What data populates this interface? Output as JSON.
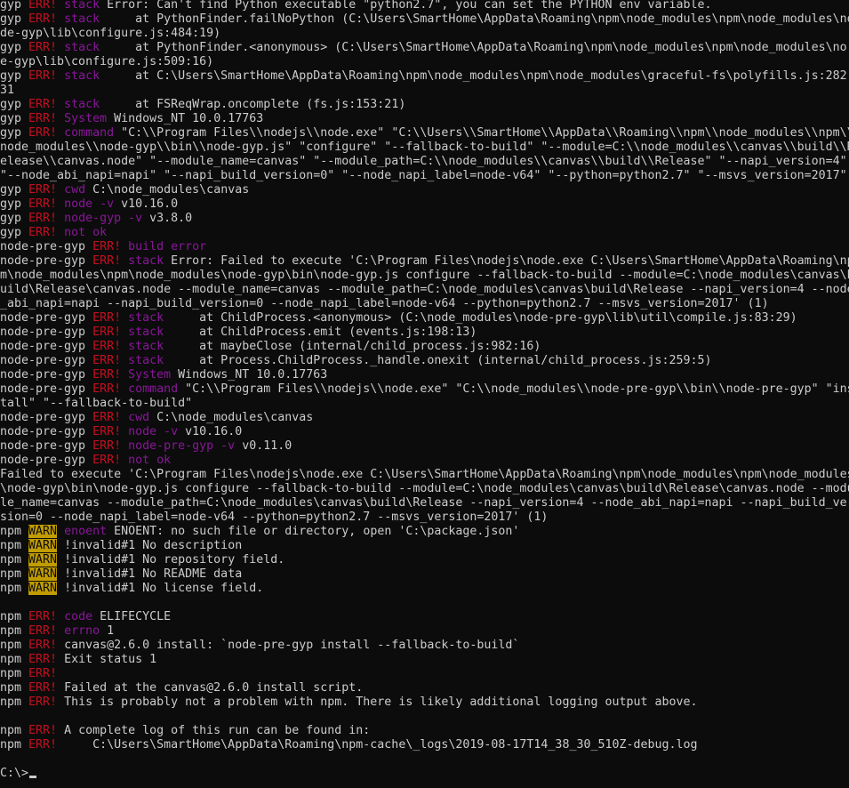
{
  "terminal": {
    "colors": {
      "background": "#0c0c0c",
      "foreground": "#cccccc",
      "err": "#c50f1f",
      "magenta": "#881798",
      "warn_bg": "#c19c00"
    },
    "lines": [
      [
        [
          "w",
          "gyp "
        ],
        [
          "r",
          "ERR! "
        ],
        [
          "m",
          "stack"
        ],
        [
          "w",
          " Error: Can't find Python executable \"python2.7\", you can set the PYTHON env variable."
        ]
      ],
      [
        [
          "w",
          "gyp "
        ],
        [
          "r",
          "ERR! "
        ],
        [
          "m",
          "stack"
        ],
        [
          "w",
          "     at PythonFinder.failNoPython (C:\\Users\\SmartHome\\AppData\\Roaming\\npm\\node_modules\\npm\\node_modules\\no"
        ]
      ],
      [
        [
          "w",
          "de-gyp\\lib\\configure.js:484:19)"
        ]
      ],
      [
        [
          "w",
          "gyp "
        ],
        [
          "r",
          "ERR! "
        ],
        [
          "m",
          "stack"
        ],
        [
          "w",
          "     at PythonFinder.<anonymous> (C:\\Users\\SmartHome\\AppData\\Roaming\\npm\\node_modules\\npm\\node_modules\\no"
        ]
      ],
      [
        [
          "w",
          "e-gyp\\lib\\configure.js:509:16)"
        ]
      ],
      [
        [
          "w",
          "gyp "
        ],
        [
          "r",
          "ERR! "
        ],
        [
          "m",
          "stack"
        ],
        [
          "w",
          "     at C:\\Users\\SmartHome\\AppData\\Roaming\\npm\\node_modules\\npm\\node_modules\\graceful-fs\\polyfills.js:282:"
        ]
      ],
      [
        [
          "w",
          "31"
        ]
      ],
      [
        [
          "w",
          "gyp "
        ],
        [
          "r",
          "ERR! "
        ],
        [
          "m",
          "stack"
        ],
        [
          "w",
          "     at FSReqWrap.oncomplete (fs.js:153:21)"
        ]
      ],
      [
        [
          "w",
          "gyp "
        ],
        [
          "r",
          "ERR! "
        ],
        [
          "m",
          "System"
        ],
        [
          "w",
          " Windows_NT 10.0.17763"
        ]
      ],
      [
        [
          "w",
          "gyp "
        ],
        [
          "r",
          "ERR! "
        ],
        [
          "m",
          "command"
        ],
        [
          "w",
          " \"C:\\\\Program Files\\\\nodejs\\\\node.exe\" \"C:\\\\Users\\\\SmartHome\\\\AppData\\\\Roaming\\\\npm\\\\node_modules\\\\npm\\\\"
        ]
      ],
      [
        [
          "w",
          "node_modules\\\\node-gyp\\\\bin\\\\node-gyp.js\" \"configure\" \"--fallback-to-build\" \"--module=C:\\\\node_modules\\\\canvas\\\\build\\\\R"
        ]
      ],
      [
        [
          "w",
          "elease\\\\canvas.node\" \"--module_name=canvas\" \"--module_path=C:\\\\node_modules\\\\canvas\\\\build\\\\Release\" \"--napi_version=4\" "
        ]
      ],
      [
        [
          "w",
          "\"--node_abi_napi=napi\" \"--napi_build_version=0\" \"--node_napi_label=node-v64\" \"--python=python2.7\" \"--msvs_version=2017\" "
        ]
      ],
      [
        [
          "w",
          "gyp "
        ],
        [
          "r",
          "ERR! "
        ],
        [
          "m",
          "cwd"
        ],
        [
          "w",
          " C:\\node_modules\\canvas"
        ]
      ],
      [
        [
          "w",
          "gyp "
        ],
        [
          "r",
          "ERR! "
        ],
        [
          "m",
          "node -v"
        ],
        [
          "w",
          " v10.16.0"
        ]
      ],
      [
        [
          "w",
          "gyp "
        ],
        [
          "r",
          "ERR! "
        ],
        [
          "m",
          "node-gyp -v"
        ],
        [
          "w",
          " v3.8.0"
        ]
      ],
      [
        [
          "w",
          "gyp "
        ],
        [
          "r",
          "ERR! "
        ],
        [
          "m",
          "not ok"
        ]
      ],
      [
        [
          "w",
          "node-pre-gyp "
        ],
        [
          "r",
          "ERR! "
        ],
        [
          "m",
          "build error"
        ]
      ],
      [
        [
          "w",
          "node-pre-gyp "
        ],
        [
          "r",
          "ERR! "
        ],
        [
          "m",
          "stack"
        ],
        [
          "w",
          " Error: Failed to execute 'C:\\Program Files\\nodejs\\node.exe C:\\Users\\SmartHome\\AppData\\Roaming\\np"
        ]
      ],
      [
        [
          "w",
          "m\\node_modules\\npm\\node_modules\\node-gyp\\bin\\node-gyp.js configure --fallback-to-build --module=C:\\node_modules\\canvas\\b"
        ]
      ],
      [
        [
          "w",
          "uild\\Release\\canvas.node --module_name=canvas --module_path=C:\\node_modules\\canvas\\build\\Release --napi_version=4 --node"
        ]
      ],
      [
        [
          "w",
          "_abi_napi=napi --napi_build_version=0 --node_napi_label=node-v64 --python=python2.7 --msvs_version=2017' (1)"
        ]
      ],
      [
        [
          "w",
          "node-pre-gyp "
        ],
        [
          "r",
          "ERR! "
        ],
        [
          "m",
          "stack"
        ],
        [
          "w",
          "     at ChildProcess.<anonymous> (C:\\node_modules\\node-pre-gyp\\lib\\util\\compile.js:83:29)"
        ]
      ],
      [
        [
          "w",
          "node-pre-gyp "
        ],
        [
          "r",
          "ERR! "
        ],
        [
          "m",
          "stack"
        ],
        [
          "w",
          "     at ChildProcess.emit (events.js:198:13)"
        ]
      ],
      [
        [
          "w",
          "node-pre-gyp "
        ],
        [
          "r",
          "ERR! "
        ],
        [
          "m",
          "stack"
        ],
        [
          "w",
          "     at maybeClose (internal/child_process.js:982:16)"
        ]
      ],
      [
        [
          "w",
          "node-pre-gyp "
        ],
        [
          "r",
          "ERR! "
        ],
        [
          "m",
          "stack"
        ],
        [
          "w",
          "     at Process.ChildProcess._handle.onexit (internal/child_process.js:259:5)"
        ]
      ],
      [
        [
          "w",
          "node-pre-gyp "
        ],
        [
          "r",
          "ERR! "
        ],
        [
          "m",
          "System"
        ],
        [
          "w",
          " Windows_NT 10.0.17763"
        ]
      ],
      [
        [
          "w",
          "node-pre-gyp "
        ],
        [
          "r",
          "ERR! "
        ],
        [
          "m",
          "command"
        ],
        [
          "w",
          " \"C:\\\\Program Files\\\\nodejs\\\\node.exe\" \"C:\\\\node_modules\\\\node-pre-gyp\\\\bin\\\\node-pre-gyp\" \"ins"
        ]
      ],
      [
        [
          "w",
          "tall\" \"--fallback-to-build\""
        ]
      ],
      [
        [
          "w",
          "node-pre-gyp "
        ],
        [
          "r",
          "ERR! "
        ],
        [
          "m",
          "cwd"
        ],
        [
          "w",
          " C:\\node_modules\\canvas"
        ]
      ],
      [
        [
          "w",
          "node-pre-gyp "
        ],
        [
          "r",
          "ERR! "
        ],
        [
          "m",
          "node -v"
        ],
        [
          "w",
          " v10.16.0"
        ]
      ],
      [
        [
          "w",
          "node-pre-gyp "
        ],
        [
          "r",
          "ERR! "
        ],
        [
          "m",
          "node-pre-gyp -v"
        ],
        [
          "w",
          " v0.11.0"
        ]
      ],
      [
        [
          "w",
          "node-pre-gyp "
        ],
        [
          "r",
          "ERR! "
        ],
        [
          "m",
          "not ok"
        ]
      ],
      [
        [
          "w",
          "Failed to execute 'C:\\Program Files\\nodejs\\node.exe C:\\Users\\SmartHome\\AppData\\Roaming\\npm\\node_modules\\npm\\node_modules"
        ]
      ],
      [
        [
          "w",
          "\\node-gyp\\bin\\node-gyp.js configure --fallback-to-build --module=C:\\node_modules\\canvas\\build\\Release\\canvas.node --modu"
        ]
      ],
      [
        [
          "w",
          "le_name=canvas --module_path=C:\\node_modules\\canvas\\build\\Release --napi_version=4 --node_abi_napi=napi --napi_build_ver"
        ]
      ],
      [
        [
          "w",
          "sion=0 --node_napi_label=node-v64 --python=python2.7 --msvs_version=2017' (1)"
        ]
      ],
      [
        [
          "w",
          "npm "
        ],
        [
          "warn",
          "WARN"
        ],
        [
          "w",
          " "
        ],
        [
          "m",
          "enoent"
        ],
        [
          "w",
          " ENOENT: no such file or directory, open 'C:\\package.json'"
        ]
      ],
      [
        [
          "w",
          "npm "
        ],
        [
          "warn",
          "WARN"
        ],
        [
          "w",
          " !invalid#1 No description"
        ]
      ],
      [
        [
          "w",
          "npm "
        ],
        [
          "warn",
          "WARN"
        ],
        [
          "w",
          " !invalid#1 No repository field."
        ]
      ],
      [
        [
          "w",
          "npm "
        ],
        [
          "warn",
          "WARN"
        ],
        [
          "w",
          " !invalid#1 No README data"
        ]
      ],
      [
        [
          "w",
          "npm "
        ],
        [
          "warn",
          "WARN"
        ],
        [
          "w",
          " !invalid#1 No license field."
        ]
      ],
      [],
      [
        [
          "w",
          "npm "
        ],
        [
          "r",
          "ERR! "
        ],
        [
          "m",
          "code"
        ],
        [
          "w",
          " ELIFECYCLE"
        ]
      ],
      [
        [
          "w",
          "npm "
        ],
        [
          "r",
          "ERR! "
        ],
        [
          "m",
          "errno"
        ],
        [
          "w",
          " 1"
        ]
      ],
      [
        [
          "w",
          "npm "
        ],
        [
          "r",
          "ERR! "
        ],
        [
          "w",
          "canvas@2.6.0 install: `node-pre-gyp install --fallback-to-build`"
        ]
      ],
      [
        [
          "w",
          "npm "
        ],
        [
          "r",
          "ERR! "
        ],
        [
          "w",
          "Exit status 1"
        ]
      ],
      [
        [
          "w",
          "npm "
        ],
        [
          "r",
          "ERR!"
        ]
      ],
      [
        [
          "w",
          "npm "
        ],
        [
          "r",
          "ERR! "
        ],
        [
          "w",
          "Failed at the canvas@2.6.0 install script."
        ]
      ],
      [
        [
          "w",
          "npm "
        ],
        [
          "r",
          "ERR! "
        ],
        [
          "w",
          "This is probably not a problem with npm. There is likely additional logging output above."
        ]
      ],
      [],
      [
        [
          "w",
          "npm "
        ],
        [
          "r",
          "ERR! "
        ],
        [
          "w",
          "A complete log of this run can be found in:"
        ]
      ],
      [
        [
          "w",
          "npm "
        ],
        [
          "r",
          "ERR! "
        ],
        [
          "w",
          "    C:\\Users\\SmartHome\\AppData\\Roaming\\npm-cache\\_logs\\2019-08-17T14_38_30_510Z-debug.log"
        ]
      ],
      [],
      [
        [
          "w",
          "C:\\>"
        ]
      ]
    ]
  }
}
